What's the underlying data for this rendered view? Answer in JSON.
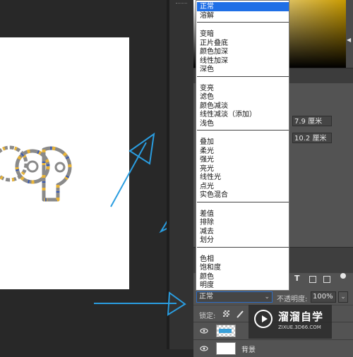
{
  "blend_mode_menu": {
    "groups": [
      [
        {
          "label": "正常",
          "selected": true
        },
        {
          "label": "溶解",
          "selected": false
        }
      ],
      [
        {
          "label": "变暗",
          "selected": false
        },
        {
          "label": "正片叠底",
          "selected": false
        },
        {
          "label": "颜色加深",
          "selected": false
        },
        {
          "label": "线性加深",
          "selected": false
        },
        {
          "label": "深色",
          "selected": false
        }
      ],
      [
        {
          "label": "变亮",
          "selected": false
        },
        {
          "label": "滤色",
          "selected": false
        },
        {
          "label": "颜色减淡",
          "selected": false
        },
        {
          "label": "线性减淡（添加）",
          "selected": false
        },
        {
          "label": "浅色",
          "selected": false
        }
      ],
      [
        {
          "label": "叠加",
          "selected": false
        },
        {
          "label": "柔光",
          "selected": false
        },
        {
          "label": "强光",
          "selected": false
        },
        {
          "label": "亮光",
          "selected": false
        },
        {
          "label": "线性光",
          "selected": false
        },
        {
          "label": "点光",
          "selected": false
        },
        {
          "label": "实色混合",
          "selected": false
        }
      ],
      [
        {
          "label": "差值",
          "selected": false
        },
        {
          "label": "排除",
          "selected": false
        },
        {
          "label": "减去",
          "selected": false
        },
        {
          "label": "划分",
          "selected": false
        }
      ],
      [
        {
          "label": "色相",
          "selected": false
        },
        {
          "label": "饱和度",
          "selected": false
        },
        {
          "label": "颜色",
          "selected": false
        },
        {
          "label": "明度",
          "selected": false
        }
      ]
    ]
  },
  "properties": {
    "width_value": "7.9 厘米",
    "height_value": "10.2 厘米"
  },
  "layers_panel": {
    "blend_mode_value": "正常",
    "opacity_label": "不透明度:",
    "opacity_value": "100%",
    "lock_label": "锁定:",
    "layers": [
      {
        "name": "",
        "visible": true
      },
      {
        "name": "背景",
        "visible": true
      }
    ]
  },
  "canvas": {
    "artwork_text": "op"
  },
  "watermark": {
    "title": "溜溜自学",
    "url": "ZIXUE.3D66.COM"
  },
  "colors": {
    "accent_blue": "#1f6fe6",
    "arrow_blue": "#2a9de0",
    "artwork_gray": "#8a8a8a",
    "artwork_yellow": "#e8b43a"
  }
}
